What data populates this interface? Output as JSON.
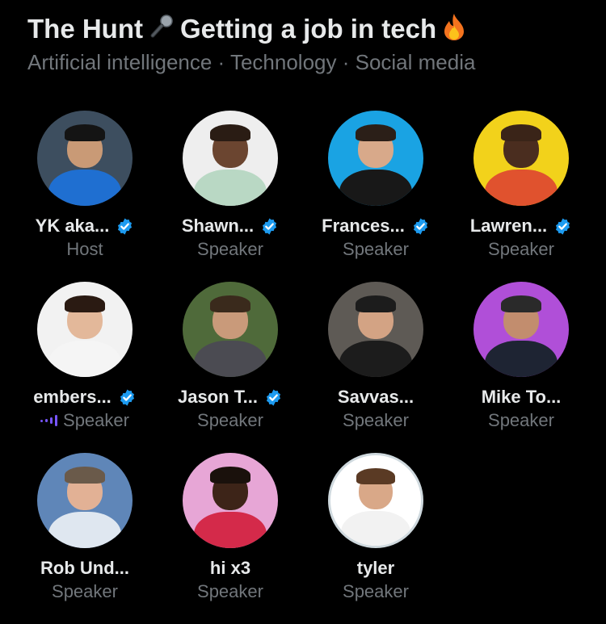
{
  "space": {
    "title_part1": "The Hunt",
    "title_part2": "Getting a job in tech",
    "topics": "Artificial intelligence · Technology · Social media"
  },
  "colors": {
    "background": "#000000",
    "primary_text": "#e7e9ea",
    "secondary_text": "#71767b",
    "verified_badge": "#1d9bf0",
    "speaking_indicator": "#7856ff"
  },
  "icons": {
    "title_mic": "microphone-icon",
    "title_fire": "fire-icon",
    "badge": "verified-badge-icon",
    "speaking": "speaking-waveform-icon"
  },
  "participants": [
    {
      "name": "YK aka...",
      "role": "Host",
      "verified": true,
      "speaking": false,
      "avatar": {
        "bg": "#3d4e5f",
        "skin": "#c99a76",
        "hair": "#141414",
        "shirt": "#1f6fd1",
        "ring": false
      }
    },
    {
      "name": "Shawn...",
      "role": "Speaker",
      "verified": true,
      "speaking": false,
      "avatar": {
        "bg": "#eeeeee",
        "skin": "#6b4530",
        "hair": "#2a1c14",
        "shirt": "#b9d8c4",
        "ring": false
      }
    },
    {
      "name": "Frances...",
      "role": "Speaker",
      "verified": true,
      "speaking": false,
      "avatar": {
        "bg": "#1aa3e3",
        "skin": "#d8a98a",
        "hair": "#2b1f18",
        "shirt": "#181818",
        "ring": false
      }
    },
    {
      "name": "Lawren...",
      "role": "Speaker",
      "verified": true,
      "speaking": false,
      "avatar": {
        "bg": "#f2d21b",
        "skin": "#4a2d1f",
        "hair": "#3a2418",
        "shirt": "#e0522e",
        "ring": false
      }
    },
    {
      "name": "embers...",
      "role": "Speaker",
      "verified": true,
      "speaking": true,
      "avatar": {
        "bg": "#f2f2f2",
        "skin": "#e3b89a",
        "hair": "#2a1a12",
        "shirt": "#f5f5f5",
        "ring": false
      }
    },
    {
      "name": "Jason T...",
      "role": "Speaker",
      "verified": true,
      "speaking": false,
      "avatar": {
        "bg": "#4f6a3a",
        "skin": "#c99a7a",
        "hair": "#3a2a1c",
        "shirt": "#4b4b52",
        "ring": false
      }
    },
    {
      "name": "Savvas...",
      "role": "Speaker",
      "verified": false,
      "speaking": false,
      "avatar": {
        "bg": "#5e5a55",
        "skin": "#d3a384",
        "hair": "#1c1c1c",
        "shirt": "#1c1c1c",
        "ring": false
      }
    },
    {
      "name": "Mike To...",
      "role": "Speaker",
      "verified": false,
      "speaking": false,
      "avatar": {
        "bg": "#b04fd8",
        "skin": "#c28d6e",
        "hair": "#2a2a2a",
        "shirt": "#1e2433",
        "ring": false
      }
    },
    {
      "name": "Rob Und...",
      "role": "Speaker",
      "verified": false,
      "speaking": false,
      "avatar": {
        "bg": "#5f86b8",
        "skin": "#e2b195",
        "hair": "#6a5a4a",
        "shirt": "#dfe7f0",
        "ring": false
      }
    },
    {
      "name": "hi x3",
      "role": "Speaker",
      "verified": false,
      "speaking": false,
      "avatar": {
        "bg": "#e7a6d6",
        "skin": "#3d2418",
        "hair": "#1a110c",
        "shirt": "#d42a4a",
        "ring": false
      }
    },
    {
      "name": "tyler",
      "role": "Speaker",
      "verified": false,
      "speaking": false,
      "avatar": {
        "bg": "#ffffff",
        "skin": "#d9a888",
        "hair": "#5a3a24",
        "shirt": "#f2f2f2",
        "ring": true
      }
    }
  ]
}
